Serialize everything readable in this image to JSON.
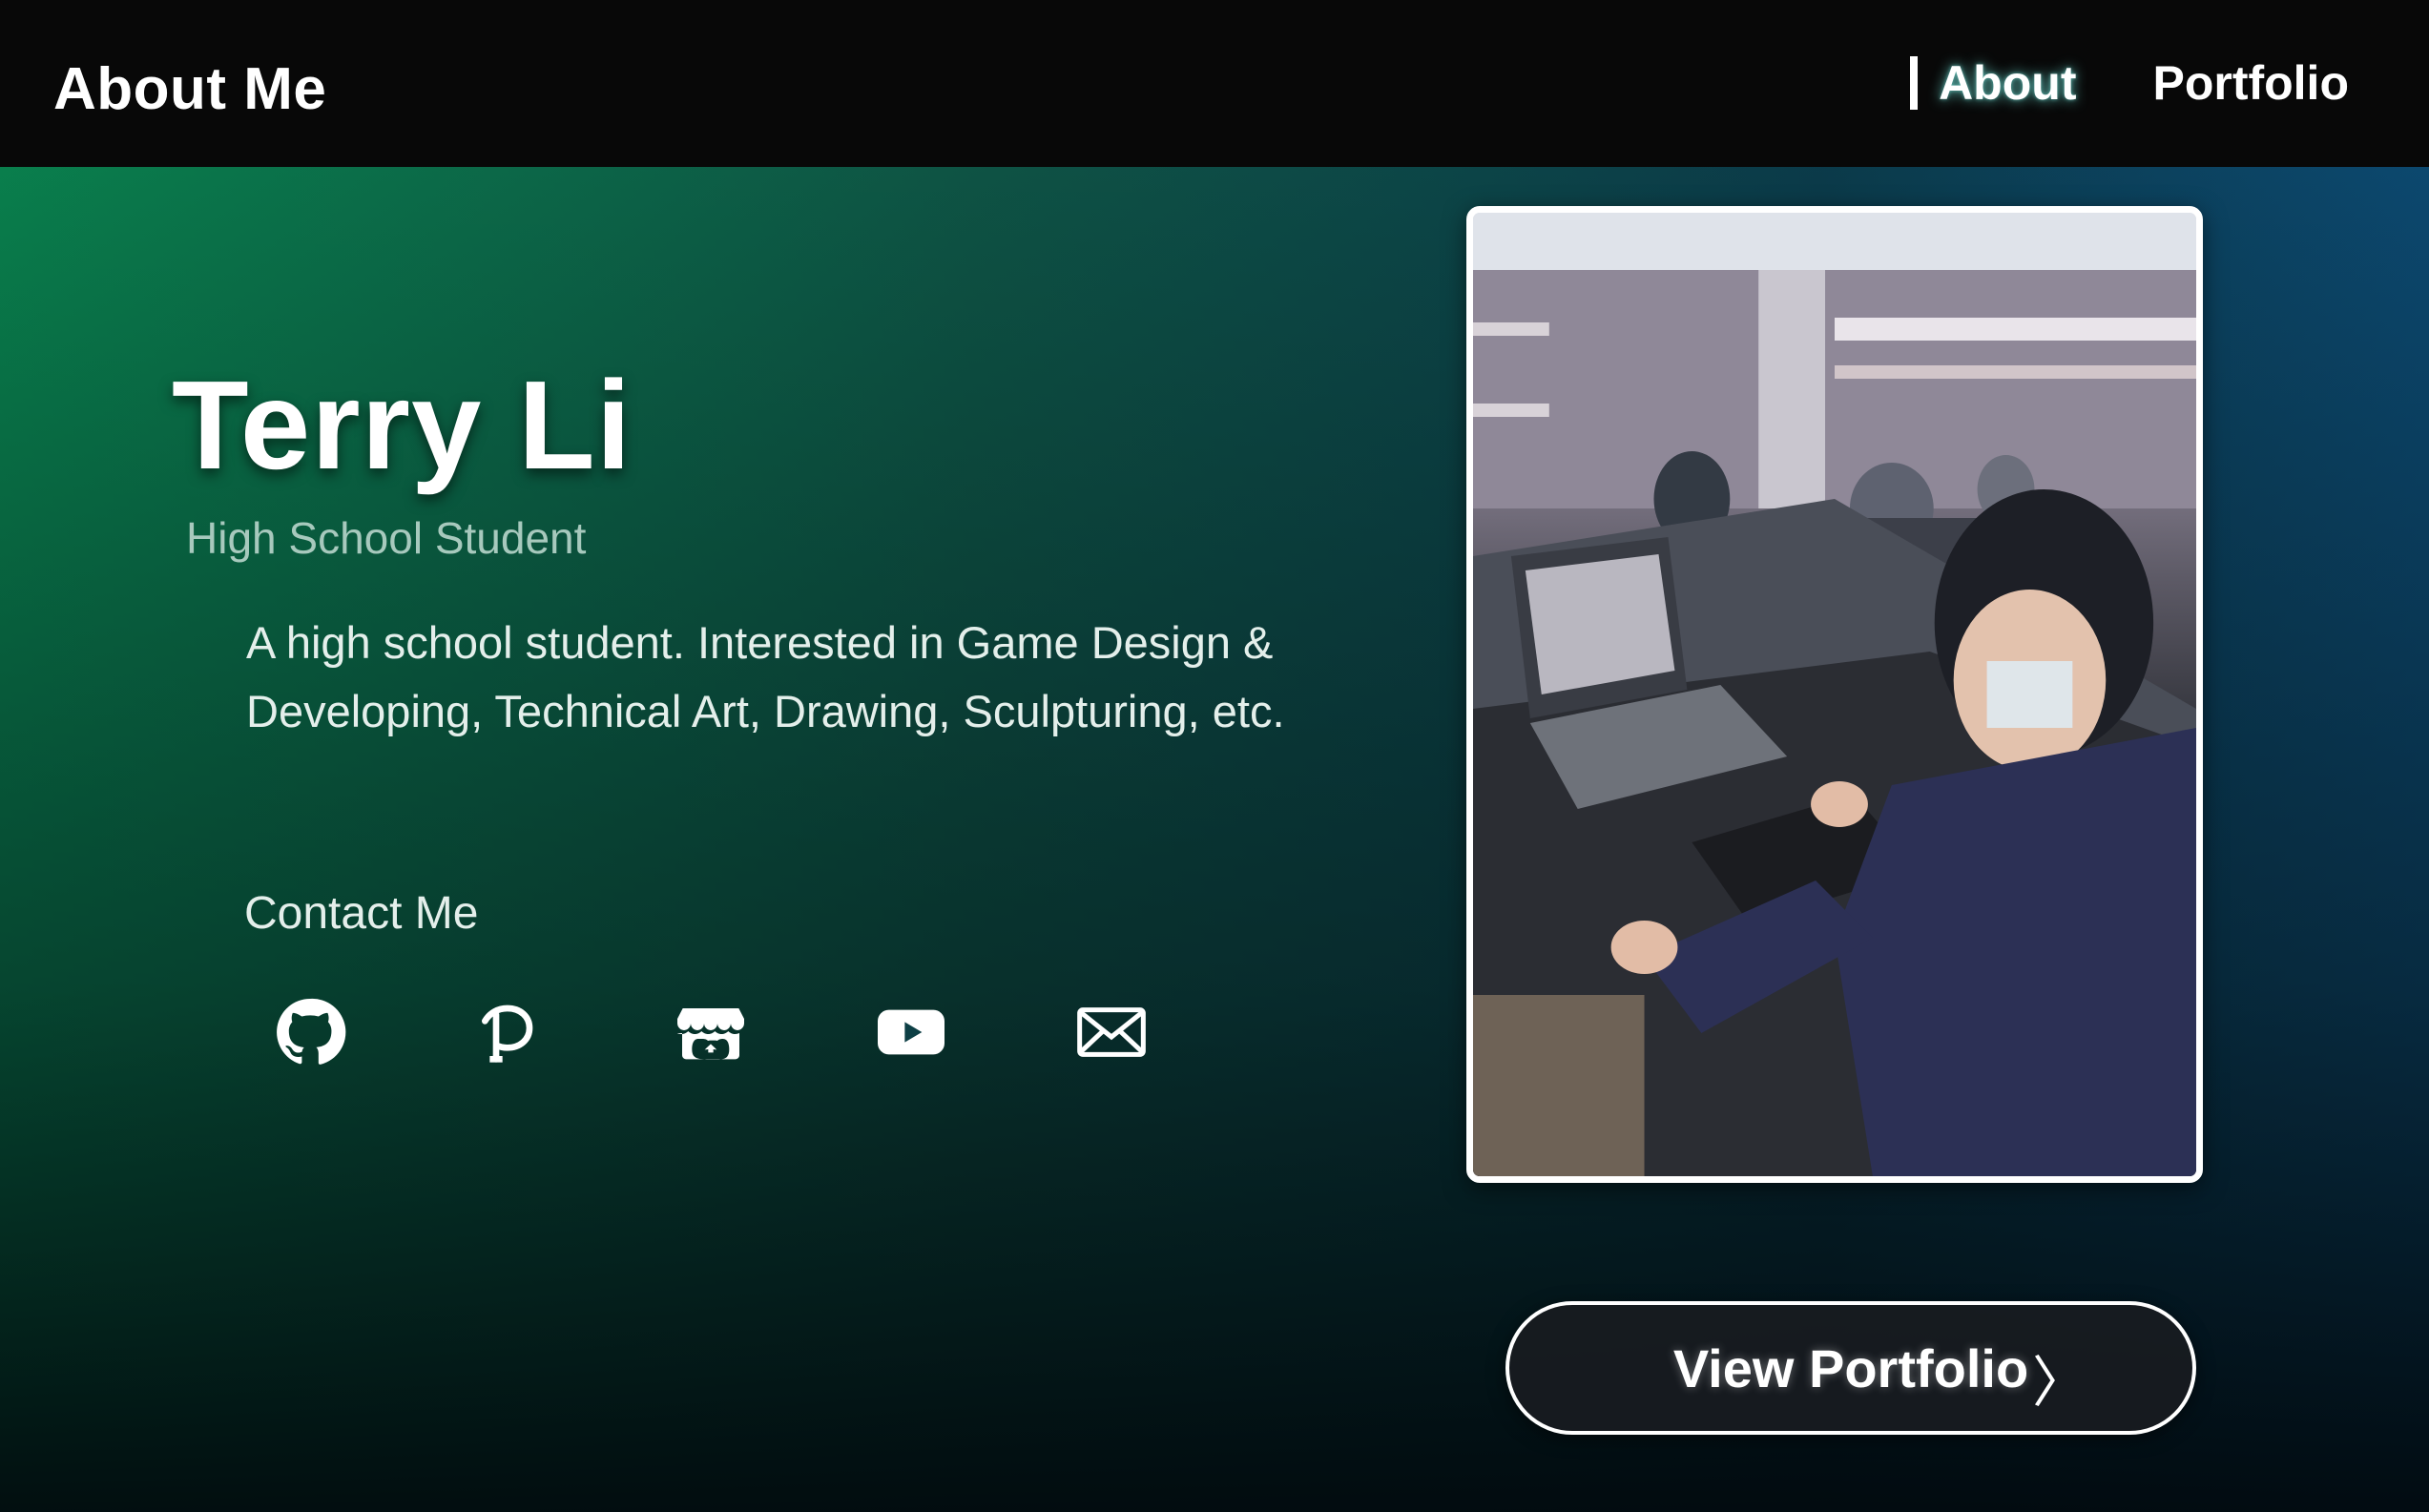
{
  "header": {
    "title": "About Me",
    "nav": [
      {
        "label": "About",
        "active": true
      },
      {
        "label": "Portfolio",
        "active": false
      }
    ]
  },
  "profile": {
    "name": "Terry Li",
    "role": "High School Student",
    "bio_line1": "A high school student. Interested in Game Design &",
    "bio_line2": "Developing, Technical Art, Drawing, Sculpturing, etc."
  },
  "contact": {
    "title": "Contact Me",
    "icons": [
      "github-icon",
      "pixiv-icon",
      "itchio-icon",
      "youtube-icon",
      "email-icon"
    ]
  },
  "cta": {
    "label": "View Portfolio",
    "arrow": "〉"
  },
  "colors": {
    "header_bg": "#080808",
    "gradient_left": "#0a8a52",
    "gradient_right": "#0d4e78",
    "role_text": "#a7c9bd"
  }
}
